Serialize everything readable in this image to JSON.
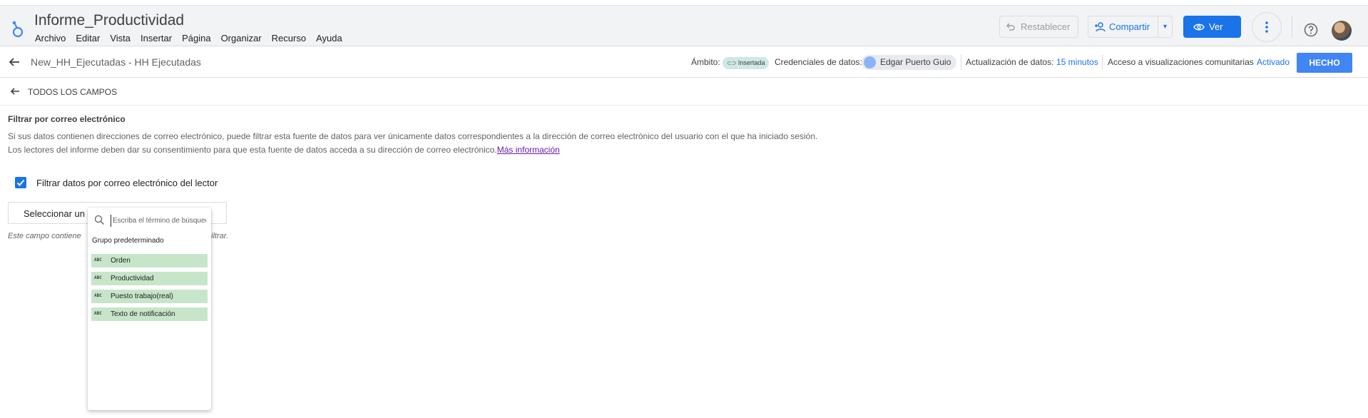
{
  "header": {
    "app_title": "Informe_Productividad",
    "menu": [
      "Archivo",
      "Editar",
      "Vista",
      "Insertar",
      "Página",
      "Organizar",
      "Recurso",
      "Ayuda"
    ],
    "reset_label": "Restablecer",
    "share_label": "Compartir",
    "view_label": "Ver"
  },
  "toolbar": {
    "datasource_title": "New_HH_Ejecutadas - HH Ejecutadas",
    "scope_label": "Ámbito:",
    "scope_value": "Insertada",
    "credentials_label": "Credenciales de datos:",
    "credentials_user": "Edgar Puerto Guio",
    "refresh_label": "Actualización de datos:",
    "refresh_value": "15 minutos",
    "community_label": "Acceso a visualizaciones comunitarias",
    "community_value": "Activado",
    "done_label": "HECHO"
  },
  "subheader": {
    "back_label": "TODOS LOS CAMPOS"
  },
  "filter_section": {
    "title": "Filtrar por correo electrónico",
    "description_1": "Si sus datos contienen direcciones de correo electrónico, puede filtrar esta fuente de datos para ver únicamente datos correspondientes a la dirección de correo electrónico del usuario con el que ha iniciado sesión.",
    "description_2": "Los lectores del informe deben dar su consentimiento para que esta fuente de datos acceda a su dirección de correo electrónico.",
    "more_info_link": "Más información",
    "checkbox_label": "Filtrar datos por correo electrónico del lector",
    "checkbox_checked": true,
    "select_label": "Seleccionar un",
    "hint_start": "Este campo contiene",
    "hint_end": "iltrar."
  },
  "dropdown": {
    "search_placeholder": "Escriba el término de búsqueda",
    "group_label": "Grupo predeterminado",
    "items": [
      {
        "type": "ABC",
        "name": "Orden"
      },
      {
        "type": "ABC",
        "name": "Productividad"
      },
      {
        "type": "ABC",
        "name": "Puesto trabajo(real)"
      },
      {
        "type": "ABC",
        "name": "Texto de notificación"
      }
    ]
  },
  "colors": {
    "accent": "#1a73e8",
    "done_button": "#4285f4",
    "field_chip": "#c7e6c9",
    "header_bg": "#f1f3f4"
  }
}
